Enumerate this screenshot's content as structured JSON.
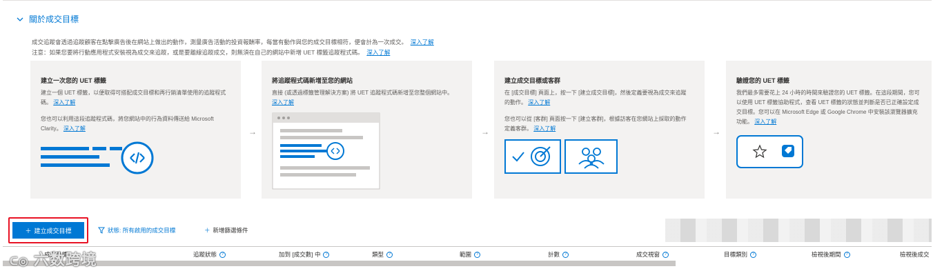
{
  "section": {
    "title": "關於成交目標"
  },
  "intro": {
    "line1": "成交追蹤會透過追蹤顧客在點擊廣告後在網站上做出的動作，測量廣告活動的投資報酬率，每當有動作與您的成交目標相符，便會計為一次成交。",
    "line1_link": "深入了解",
    "line2": "注意：如果您要將行動應用程式安裝視為成交來追蹤，或是要離線追蹤成交，則無須在自己的網站中新增 UET 標籤追蹤程式碼。",
    "line2_link": "深入了解"
  },
  "cards": [
    {
      "title": "建立一次您的 UET 標籤",
      "text": "建立一個 UET 標籤，以便取得可搭配成交目標和再行銷清單使用的追蹤程式碼。",
      "link": "深入了解",
      "text2": "您也可以利用這段追蹤程式碼，將您網站中的行為資料傳送給 Microsoft Clarity。",
      "link2": "深入了解"
    },
    {
      "title": "將追蹤程式碼新增至您的網站",
      "text": "直接 (或透過標籤管理解決方案) 將 UET 追蹤程式碼新增至您整個網站中。",
      "link": "深入了解"
    },
    {
      "title": "建立成交目標或客群",
      "text": "在 [成交目標] 頁面上，按一下 [建立成交目標]，然後定義要視為成交來追蹤的動作。",
      "link": "深入了解",
      "text2": "您也可以從 [客群] 頁面按一下 [建立客群]，根據訪客在您網站上採取的動作定義客群。",
      "link2": "深入了解"
    },
    {
      "title": "驗證您的 UET 標籤",
      "text": "我們最多需要花上 24 小時的時間來驗證您的 UET 標籤。在這段期間，您可以使用 UET 標籤協助程式，查看 UET 標籤的狀態並判斷是否已正確設定成交目標。您可以在 Microsoft Edge 或 Google Chrome 中安裝該瀏覽器擴充功能。",
      "link": "深入了解"
    }
  ],
  "toolbar": {
    "create_label": "建立成交目標",
    "filter_label": "狀態: 所有啟用的成交目標",
    "add_filter_label": "新增篩選條件"
  },
  "columns": [
    "成交目標",
    "追蹤狀態",
    "加到 [成交數] 中",
    "類型",
    "範圍",
    "計數",
    "成交視窗",
    "目標類別",
    "檢視後期間",
    "檢視後成交"
  ],
  "watermark": "六数跨境",
  "colors": {
    "accent": "#0078d4",
    "highlight": "#e81123",
    "card_bg": "#f3f2f1"
  }
}
